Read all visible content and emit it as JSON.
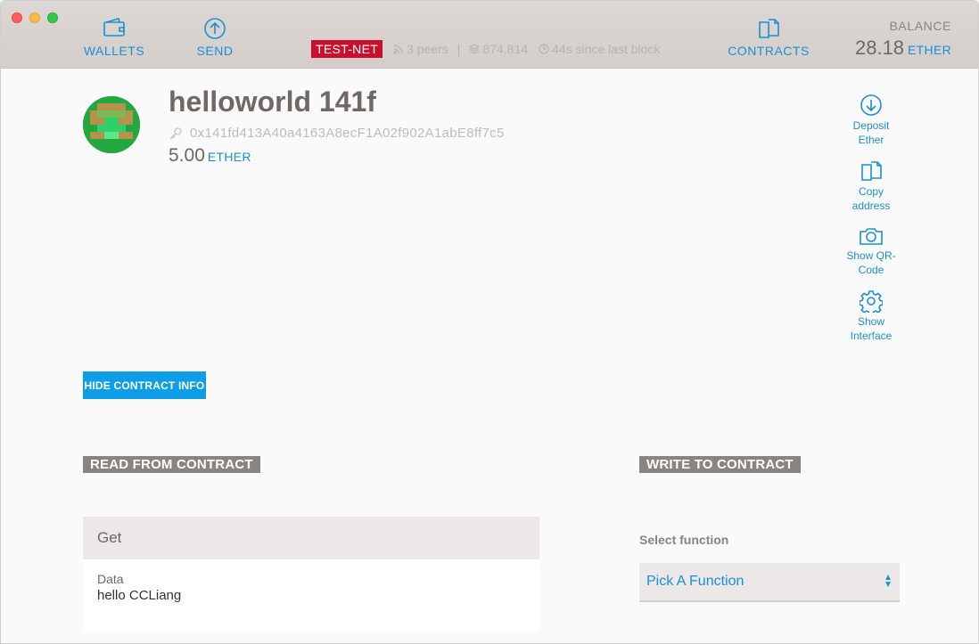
{
  "header": {
    "nav": {
      "wallets": "WALLETS",
      "send": "SEND",
      "contracts": "CONTRACTS"
    },
    "status": {
      "network": "TEST-NET",
      "peers": "3 peers",
      "block": "874,814",
      "since_last_block": "44s since last block"
    },
    "balance": {
      "label": "BALANCE",
      "amount": "28.18",
      "unit": "ETHER"
    }
  },
  "account": {
    "name": "helloworld 141f",
    "address": "0x141fd413A40a4163A8ecF1A02f902A1abE8ff7c5",
    "balance": "5.00",
    "unit": "ETHER"
  },
  "actions": {
    "deposit": "Deposit Ether",
    "copy": "Copy address",
    "qr": "Show QR-Code",
    "interface": "Show Interface"
  },
  "hide_button": "HIDE CONTRACT INFO",
  "read": {
    "title": "READ FROM CONTRACT",
    "function_name": "Get",
    "field_label": "Data",
    "field_value": "hello CCLiang"
  },
  "write": {
    "title": "WRITE TO CONTRACT",
    "select_label": "Select function",
    "select_value": "Pick A Function"
  },
  "colors": {
    "accent": "#1a8fd6",
    "testnet": "#c8102e",
    "button": "#0e9ee8"
  }
}
